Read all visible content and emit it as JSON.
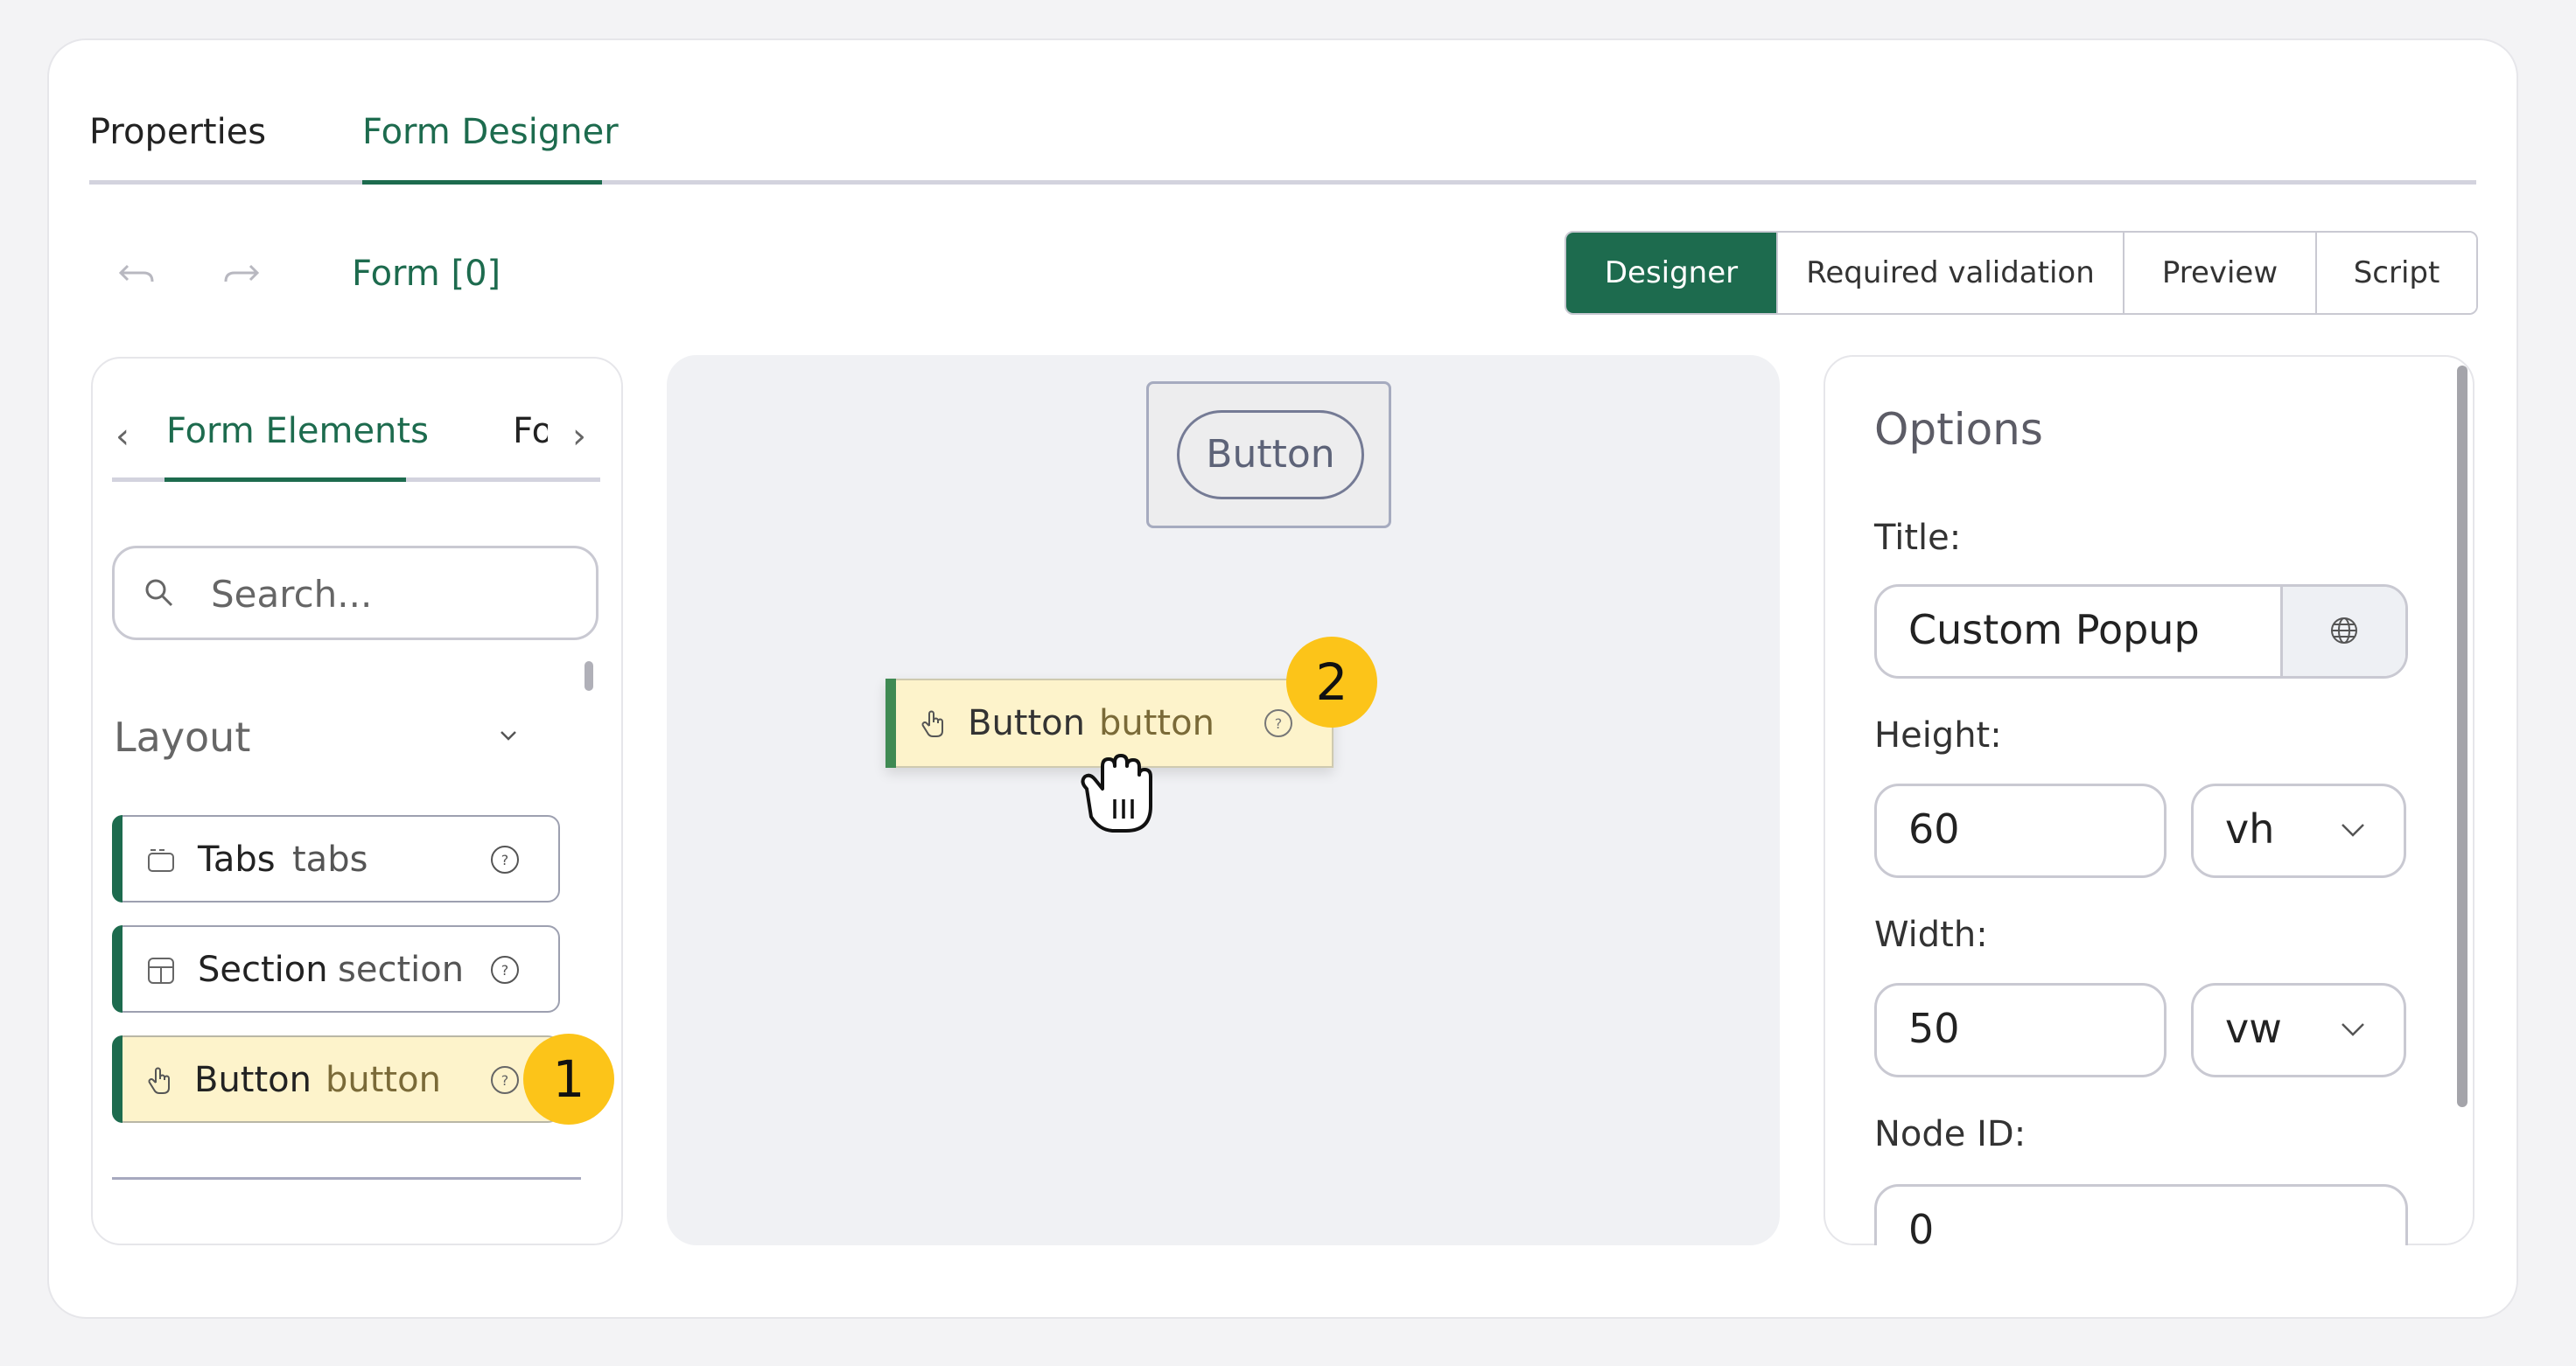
{
  "tabs": {
    "properties": "Properties",
    "form_designer": "Form Designer"
  },
  "toolbar": {
    "undo_icon": "undo-icon",
    "redo_icon": "redo-icon",
    "form_label": "Form [0]",
    "modes": [
      "Designer",
      "Required validation",
      "Preview",
      "Script"
    ],
    "active_mode": "Designer"
  },
  "left_panel": {
    "tab_active": "Form Elements",
    "tab_next": "Fo",
    "search_placeholder": "Search...",
    "section_title": "Layout",
    "items": [
      {
        "label": "Tabs",
        "type": "tabs",
        "icon": "tabs-icon"
      },
      {
        "label": "Section",
        "type": "section",
        "icon": "section-icon"
      },
      {
        "label": "Button",
        "type": "button",
        "icon": "pointer-hand-icon"
      }
    ]
  },
  "canvas": {
    "button_label": "Button",
    "dragging": {
      "label": "Button",
      "type": "button"
    }
  },
  "badges": {
    "first": "1",
    "second": "2"
  },
  "options": {
    "title": "Options",
    "title_label": "Title:",
    "title_value": "Custom Popup",
    "height_label": "Height:",
    "height_value": "60",
    "height_unit": "vh",
    "width_label": "Width:",
    "width_value": "50",
    "width_unit": "vw",
    "node_id_label": "Node ID:",
    "node_id_value": "0"
  },
  "colors": {
    "accent": "#1d6b4e",
    "highlight": "#fdf3cb",
    "badge": "#fcc419"
  }
}
